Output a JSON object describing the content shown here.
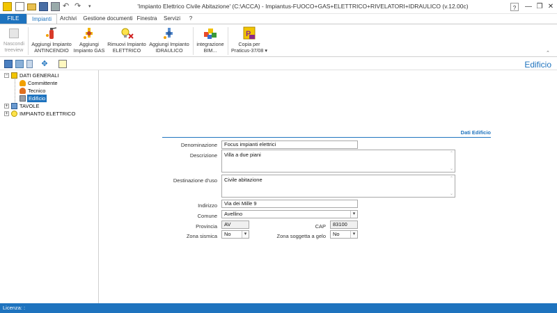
{
  "window": {
    "title": "'Impianto Elettrico Civile Abitazione' (C:\\ACCA) - Impiantus-FUOCO+GAS+ELETTRICO+RIVELATORI+IDRAULICO (v.12.00c)",
    "controls": {
      "help": "?",
      "restore": "❐",
      "minimize": "—",
      "close": "✕"
    }
  },
  "ribbon_tabs": [
    "FILE",
    "Impianti",
    "Archivi",
    "Gestione documenti",
    "Finestra",
    "Servizi",
    "?"
  ],
  "ribbon": {
    "nascondi": [
      "Nascondi",
      "treeview"
    ],
    "antincendio": [
      "Aggiungi Impianto",
      "ANTINCENDIO"
    ],
    "gas": [
      "Aggiungi",
      "Impianto GAS"
    ],
    "rimuovi": [
      "Rimuovi Impianto",
      "ELETTRICO"
    ],
    "idraulico": [
      "Aggiungi Impianto",
      "IDRAULICO"
    ],
    "bim": [
      "integrazione",
      "BIM..."
    ],
    "copia": [
      "Copia per",
      "Praticus-37/08 ▾"
    ]
  },
  "section_title": "Edificio",
  "tree": {
    "dati_generali": "DATI GENERALI",
    "committente": "Committente",
    "tecnico": "Tecnico",
    "edificio": "Edificio",
    "tavole": "TAVOLE",
    "impianto_elettrico": "IMPIANTO ELETTRICO"
  },
  "form": {
    "header": "Dati Edificio",
    "denominazione": {
      "label": "Denominazione",
      "value": "Focus impianti elettrici"
    },
    "descrizione": {
      "label": "Descrizione",
      "value": "Villa a due piani"
    },
    "destinazione": {
      "label": "Destinazione d'uso",
      "value": "Civile abitazione"
    },
    "indirizzo": {
      "label": "Indirizzo",
      "value": "Via dei Mille 9"
    },
    "comune": {
      "label": "Comune",
      "value": "Avellino"
    },
    "provincia": {
      "label": "Provincia",
      "value": "AV"
    },
    "cap": {
      "label": "CAP",
      "value": "83100"
    },
    "zona_sismica": {
      "label": "Zona sismica",
      "value": "No"
    },
    "zona_gelo": {
      "label": "Zona soggetta a gelo",
      "value": "No"
    }
  },
  "status": {
    "licenza": "Licenza: :"
  },
  "colors": {
    "accent": "#1e73be",
    "status_bar": "#1e73be"
  }
}
